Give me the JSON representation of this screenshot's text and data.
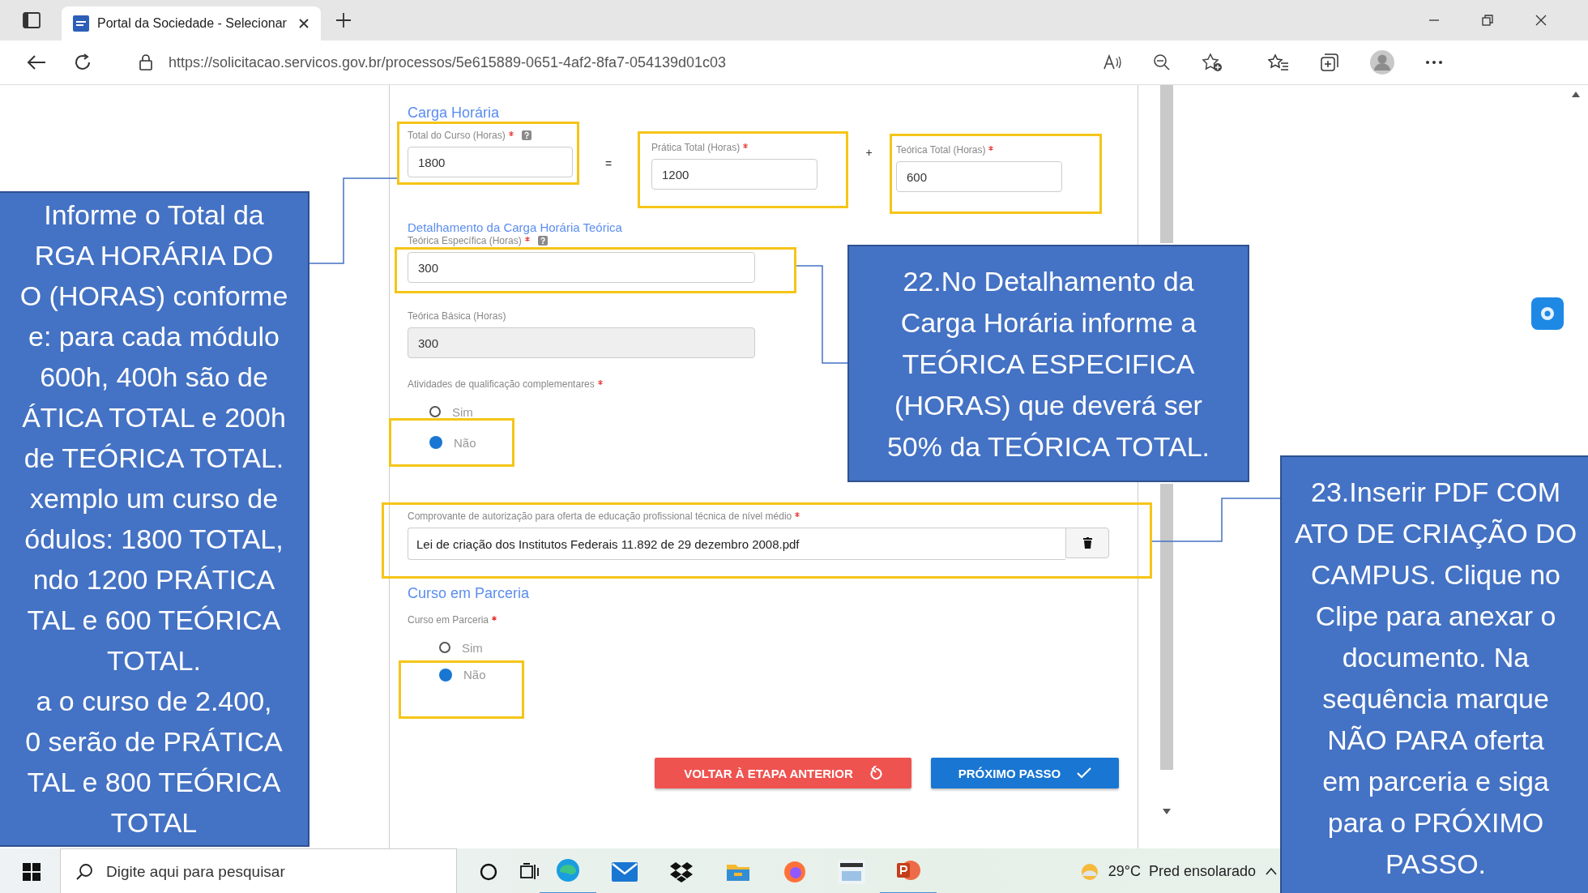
{
  "browser": {
    "tab": {
      "title": "Portal da Sociedade - Selecionar"
    },
    "url": "https://solicitacao.servicos.gov.br/processos/5e615889-0651-4af2-8fa7-054139d01c03"
  },
  "form": {
    "section_title": "Carga Horária",
    "totals": [
      {
        "label": "Total do Curso (Horas)",
        "required": true,
        "help": true,
        "value": "1800",
        "highlighted": true
      },
      {
        "label": "Prática Total (Horas)",
        "required": true,
        "help": false,
        "value": "1200",
        "highlighted": true
      },
      {
        "label": "Teórica Total (Horas)",
        "required": true,
        "help": false,
        "value": "600",
        "highlighted": true
      }
    ],
    "operators": [
      "=",
      "+"
    ],
    "detail_title": "Detalhamento da Carga Horária Teórica",
    "specific": {
      "label": "Teórica Específica (Horas)",
      "required": true,
      "help": true,
      "value": "300",
      "highlighted": true
    },
    "basic": {
      "label": "Teórica Básica (Horas)",
      "value": "300",
      "disabled": true
    },
    "activities": {
      "label": "Atividades de qualificação complementares",
      "required": true,
      "options": [
        {
          "label": "Sim",
          "selected": false,
          "highlighted": false
        },
        {
          "label": "Não",
          "selected": true,
          "highlighted": true
        }
      ]
    },
    "upload": {
      "label": "Comprovante de autorização para oferta de educação profissional técnica de nível médio",
      "required": true,
      "file": "Lei de criação dos Institutos Federais 11.892 de 29 dezembro 2008.pdf",
      "highlighted": true
    },
    "partnership_title": "Curso em Parceria",
    "partnership": {
      "label": "Curso em Parceria",
      "required": true,
      "options": [
        {
          "label": "Sim",
          "selected": false,
          "highlighted": false
        },
        {
          "label": "Não",
          "selected": true,
          "highlighted": true
        }
      ]
    },
    "buttons": [
      {
        "label": "VOLTAR À ETAPA ANTERIOR",
        "kind": "back"
      },
      {
        "label": "PRÓXIMO PASSO",
        "kind": "next"
      }
    ]
  },
  "callouts": [
    {
      "lines": [
        "Informe o Total da",
        "RGA HORÁRIA DO",
        "O (HORAS) conforme",
        "e: para  cada módulo",
        "600h, 400h são de",
        "ÁTICA TOTAL e 200h",
        "de TEÓRICA TOTAL.",
        "xemplo um curso de",
        "ódulos: 1800 TOTAL,",
        "ndo 1200 PRÁTICA",
        "TAL e 600 TEÓRICA",
        "TOTAL.",
        "a o curso de 2.400,",
        "0 serão de PRÁTICA",
        "TAL e 800 TEÓRICA",
        "TOTAL"
      ]
    },
    {
      "lines": [
        "22.No Detalhamento da",
        "Carga Horária informe a",
        "TEÓRICA ESPECIFICA",
        "(HORAS) que deverá ser",
        "50% da TEÓRICA TOTAL."
      ]
    },
    {
      "lines": [
        "23.Inserir PDF COM",
        "ATO DE CRIAÇÃO DO",
        "CAMPUS. Clique no",
        "Clipe para anexar o",
        "documento. Na",
        "sequência marque",
        "NÃO PARA oferta",
        "em parceria e siga",
        "para o PRÓXIMO",
        "PASSO."
      ]
    }
  ],
  "taskbar": {
    "search_placeholder": "Digite aqui para pesquisar",
    "weather": "29°C  Pred ensolarado"
  }
}
